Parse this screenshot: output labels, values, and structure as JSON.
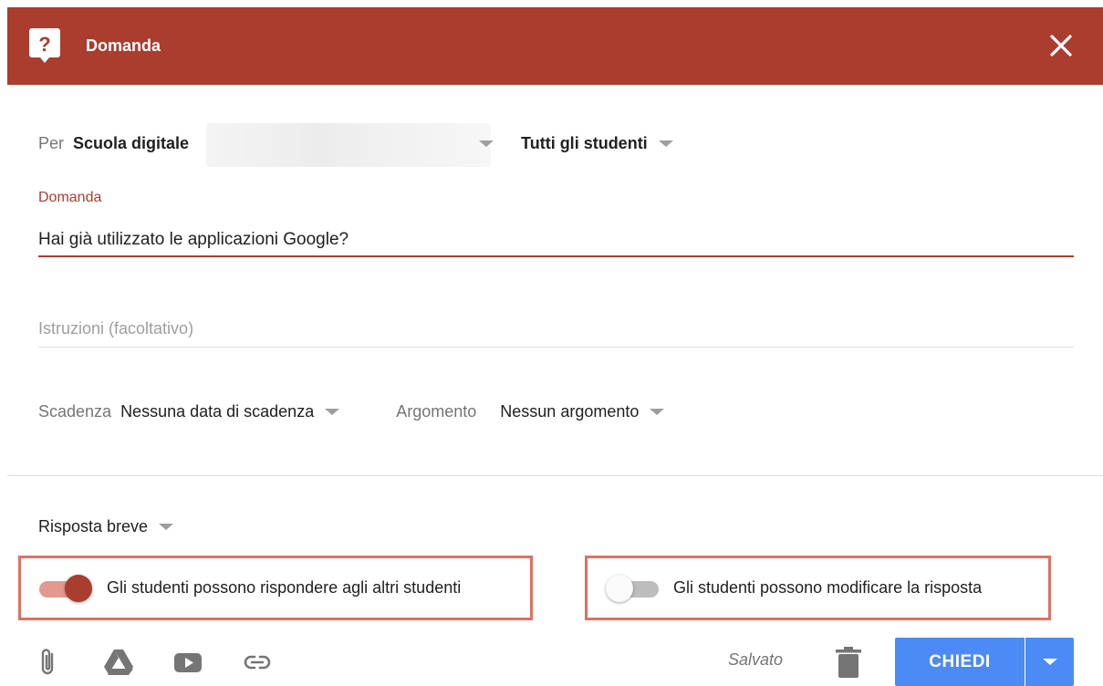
{
  "colors": {
    "brand": "#ab3d2f",
    "accent": "#4c8bf5",
    "highlight": "#e07060"
  },
  "header": {
    "title": "Domanda",
    "icon": "question-bubble-icon",
    "close_icon": "close-icon"
  },
  "audience": {
    "prefix": "Per",
    "class_name": "Scuola digitale",
    "students": "Tutti gli studenti"
  },
  "question": {
    "label": "Domanda",
    "value": "Hai già utilizzato le applicazioni Google?"
  },
  "instructions": {
    "placeholder": "Istruzioni (facoltativo)",
    "value": ""
  },
  "due": {
    "label": "Scadenza",
    "value": "Nessuna data di scadenza"
  },
  "topic": {
    "label": "Argomento",
    "value": "Nessun argomento"
  },
  "answer_type": {
    "value": "Risposta breve"
  },
  "toggles": {
    "reply_to_others": {
      "label": "Gli studenti possono rispondere agli altri studenti",
      "on": true
    },
    "edit_answer": {
      "label": "Gli studenti possono modificare la risposta",
      "on": false
    }
  },
  "footer": {
    "icons": [
      "paperclip-icon",
      "google-drive-icon",
      "youtube-icon",
      "link-icon"
    ],
    "status": "Salvato",
    "trash_icon": "trash-icon",
    "ask_label": "CHIEDI",
    "menu_icon": "caret-down-icon"
  }
}
